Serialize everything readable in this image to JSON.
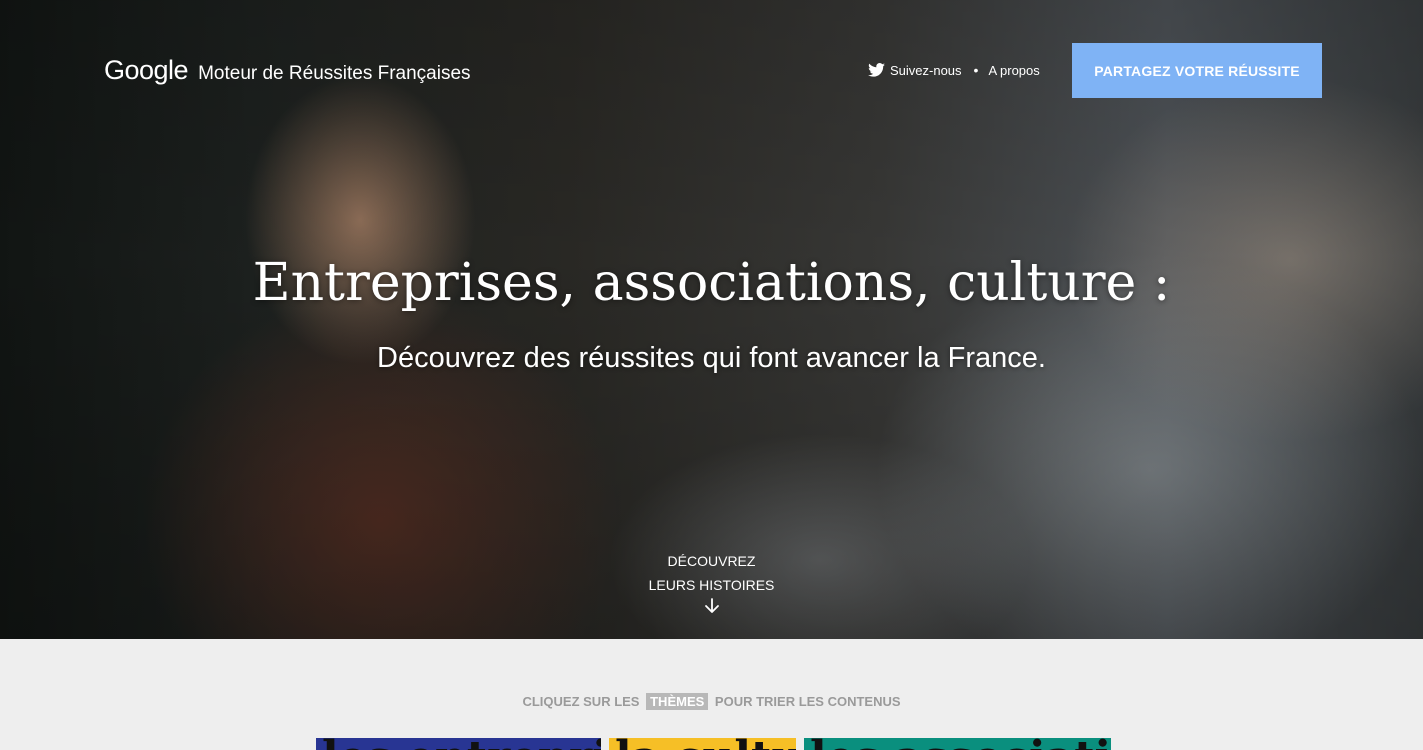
{
  "header": {
    "logo": "Google",
    "site_name": "Moteur de Réussites Françaises",
    "nav": {
      "follow_label": "Suivez-nous",
      "separator": "•",
      "about_label": "A propos"
    },
    "cta_label": "PARTAGEZ VOTRE RÉUSSITE"
  },
  "hero": {
    "title": "Entreprises, associations, culture :",
    "subtitle": "Découvrez des réussites qui font avancer la France.",
    "discover_line1": "DÉCOUVREZ",
    "discover_line2": "LEURS HISTOIRES",
    "arrow_icon": "arrow-down-icon"
  },
  "filter": {
    "prefix": "CLIQUEZ SUR LES",
    "highlight": "THÈMES",
    "suffix": "POUR TRIER LES CONTENUS"
  },
  "theme_cards": [
    {
      "label": "les entreprises",
      "color": "#283593"
    },
    {
      "label": "la culture",
      "color": "#f6bf26"
    },
    {
      "label": "les associations",
      "color": "#0a8f7e"
    }
  ],
  "colors": {
    "cta_background": "#7fb3f5",
    "page_background": "#eeeeee"
  }
}
